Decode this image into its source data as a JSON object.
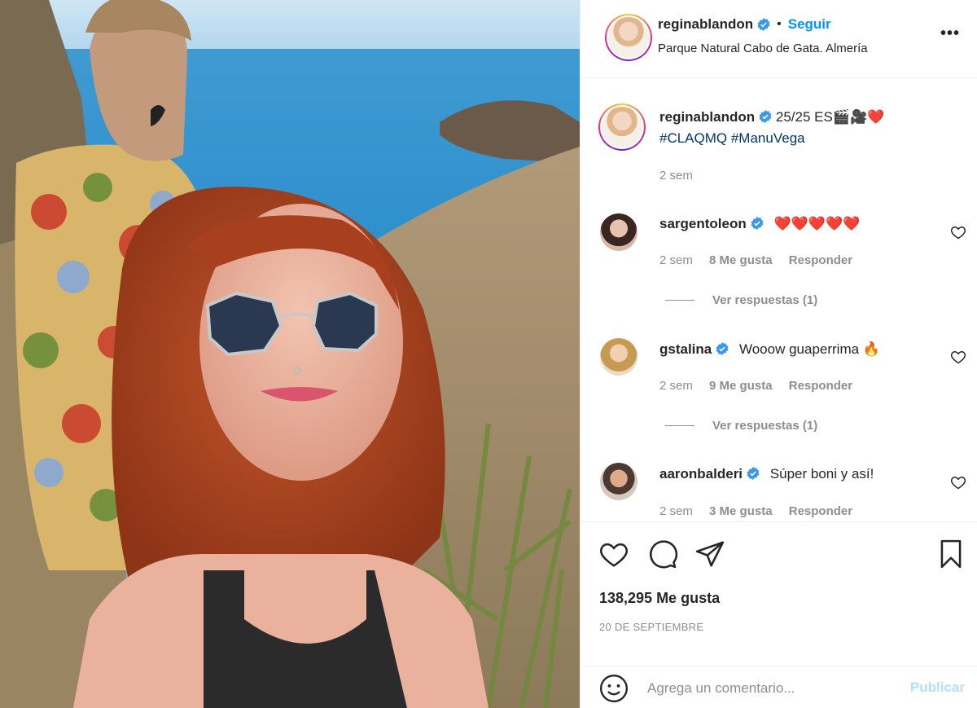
{
  "post": {
    "username": "reginablandon",
    "follow_label": "Seguir",
    "dot": "•",
    "location": "Parque Natural Cabo de Gata. Almería",
    "more_label": "•••"
  },
  "caption": {
    "username": "reginablandon",
    "text": "25/25 ES🎬🎥❤️",
    "hashtags": "#CLAQMQ #ManuVega",
    "time": "2 sem"
  },
  "comments": [
    {
      "username": "sargentoleon",
      "text": "❤️❤️❤️❤️❤️",
      "time": "2 sem",
      "likes": "8 Me gusta",
      "reply": "Responder",
      "view_replies": "Ver respuestas (1)"
    },
    {
      "username": "gstalina",
      "text": "Wooow guaperrima 🔥",
      "time": "2 sem",
      "likes": "9 Me gusta",
      "reply": "Responder",
      "view_replies": "Ver respuestas (1)"
    },
    {
      "username": "aaronbalderi",
      "text": "Súper boni y así!",
      "time": "2 sem",
      "likes": "3 Me gusta",
      "reply": "Responder"
    }
  ],
  "stats": {
    "likes": "138,295 Me gusta",
    "date": "20 DE SEPTIEMBRE"
  },
  "add_comment": {
    "placeholder": "Agrega un comentario...",
    "publish_label": "Publicar"
  },
  "colors": {
    "accent": "#0095f6",
    "hashtag": "#00376b",
    "muted": "#8e8e8e",
    "publish_disabled": "#b2dffc",
    "verified": "#3897f0"
  },
  "icons": [
    "verified-badge-icon",
    "more-options-icon",
    "heart-icon",
    "comment-icon",
    "share-icon",
    "save-icon",
    "emoji-icon"
  ]
}
